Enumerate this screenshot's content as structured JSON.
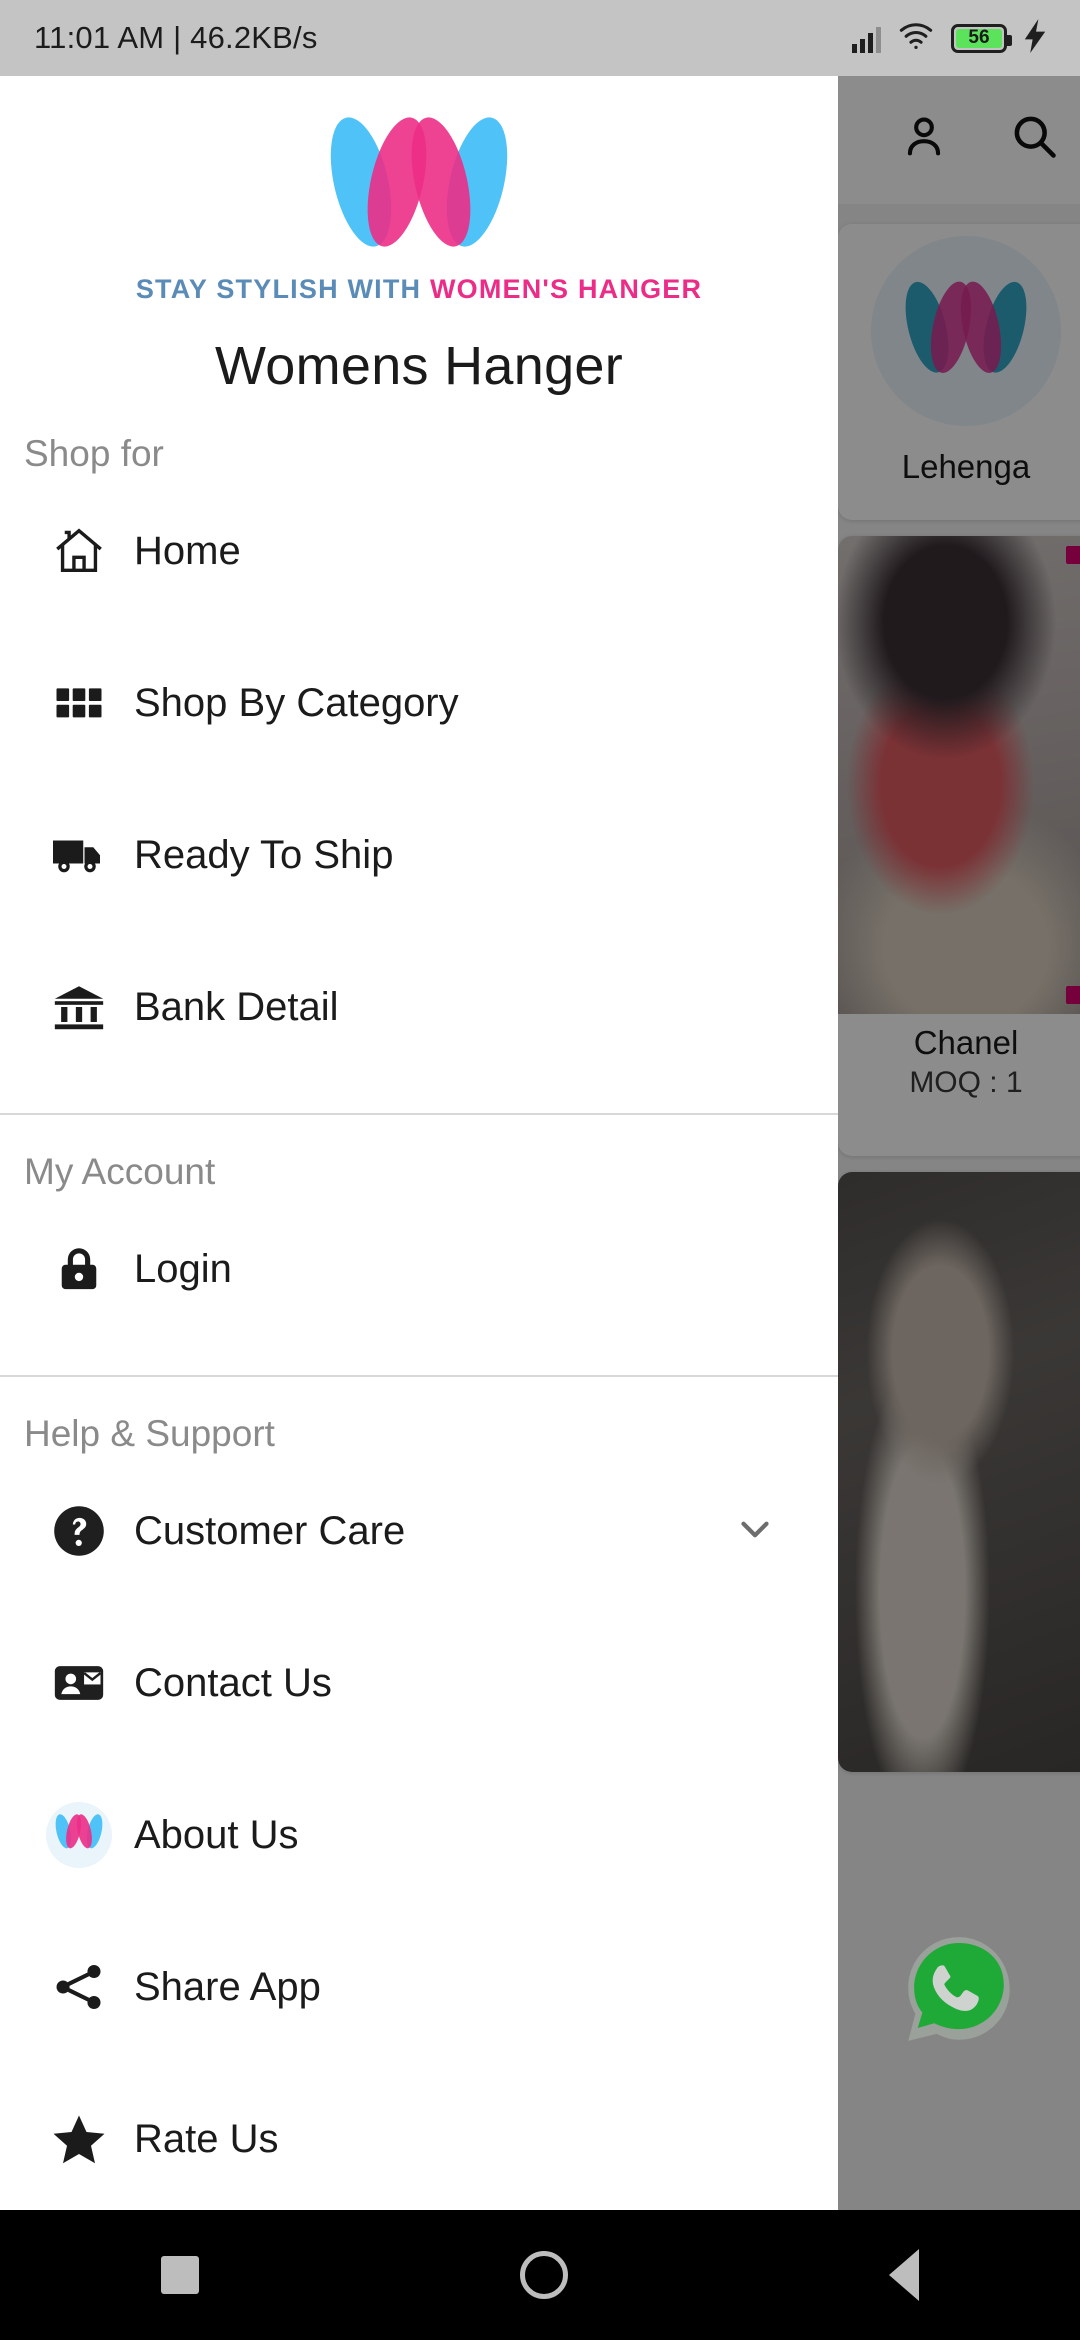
{
  "status_bar": {
    "time_and_speed": "11:01 AM | 46.2KB/s",
    "battery_level": "56",
    "signal_icon": "signal-bars-icon",
    "wifi_icon": "wifi-icon",
    "charging_icon": "charging-bolt-icon"
  },
  "drawer": {
    "logo_icon": "womens-hanger-logo",
    "tagline_prefix": "STAY STYLISH WITH",
    "tagline_suffix": "WOMEN'S HANGER",
    "app_title": "Womens Hanger",
    "sections": [
      {
        "label": "Shop for",
        "items": [
          {
            "label": "Home",
            "icon": "home-icon"
          },
          {
            "label": "Shop By Category",
            "icon": "grid-icon"
          },
          {
            "label": "Ready To Ship",
            "icon": "truck-icon"
          },
          {
            "label": "Bank Detail",
            "icon": "bank-icon"
          }
        ]
      },
      {
        "label": "My Account",
        "items": [
          {
            "label": "Login",
            "icon": "lock-icon"
          }
        ]
      },
      {
        "label": "Help & Support",
        "items": [
          {
            "label": "Customer Care",
            "icon": "help-circle-icon",
            "trailing": "chevron-down-icon"
          },
          {
            "label": "Contact Us",
            "icon": "contact-mail-icon"
          },
          {
            "label": "About Us",
            "icon": "about-logo-icon"
          },
          {
            "label": "Share App",
            "icon": "share-icon"
          },
          {
            "label": "Rate Us",
            "icon": "star-icon"
          }
        ]
      }
    ]
  },
  "background": {
    "appbar": {
      "account_icon": "person-icon",
      "search_icon": "search-icon"
    },
    "cards": [
      {
        "title": "Lehenga",
        "moq": ""
      },
      {
        "title": "Chanel",
        "moq": "MOQ : 1"
      }
    ],
    "whatsapp_fab_icon": "whatsapp-icon"
  },
  "nav_bar": {
    "recents_icon": "square-recents-icon",
    "home_icon": "circle-home-icon",
    "back_icon": "triangle-back-icon"
  },
  "colors": {
    "brand_pink": "#ec2d87",
    "brand_cyan": "#4fc3f7",
    "tagline_blue": "#5b8cb8",
    "whatsapp_green": "#1faa38",
    "battery_green": "#5ce35c"
  }
}
